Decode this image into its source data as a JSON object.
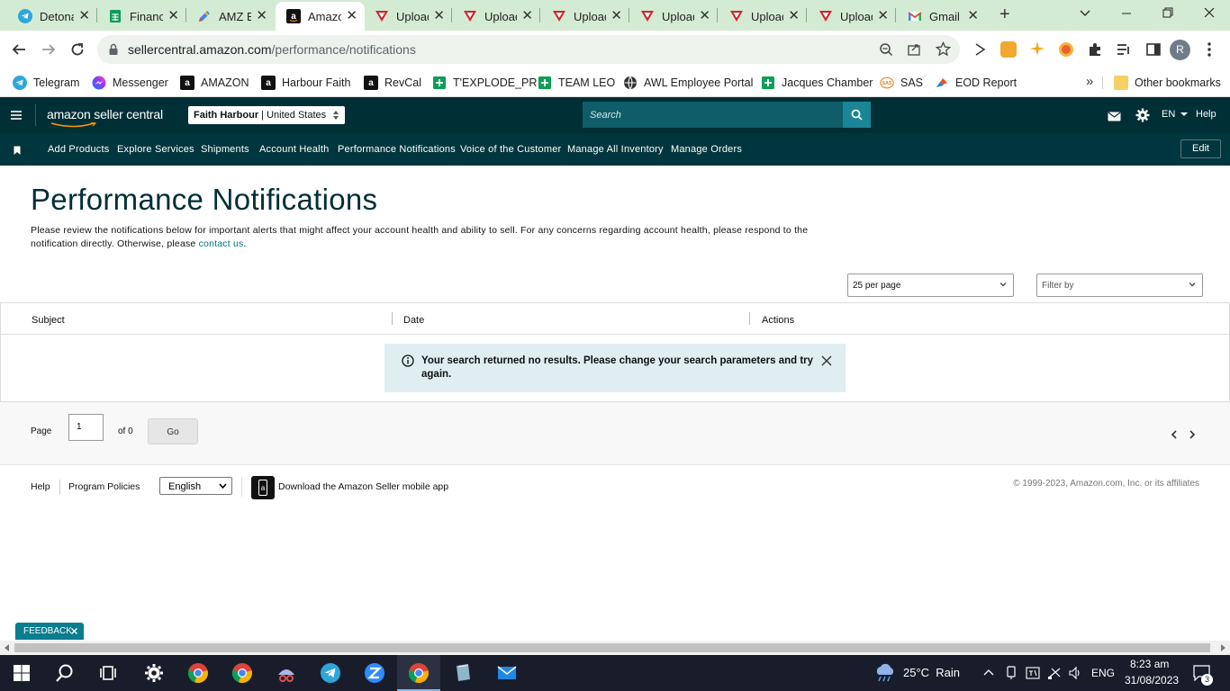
{
  "browser": {
    "tabs": [
      {
        "title": "Detonate",
        "icon": "telegram-icon",
        "active": false
      },
      {
        "title": "Financials",
        "icon": "sheets-icon",
        "active": false
      },
      {
        "title": "AMZ Ex",
        "icon": "edit-icon",
        "active": false
      },
      {
        "title": "Amazon",
        "icon": "amazon-icon",
        "active": true
      },
      {
        "title": "Upload",
        "icon": "upload-icon",
        "active": false
      },
      {
        "title": "Upload",
        "icon": "upload-icon",
        "active": false
      },
      {
        "title": "Upload",
        "icon": "upload-icon",
        "active": false
      },
      {
        "title": "Upload",
        "icon": "upload-icon",
        "active": false
      },
      {
        "title": "Upload",
        "icon": "upload-icon",
        "active": false
      },
      {
        "title": "Upload",
        "icon": "upload-icon",
        "active": false
      },
      {
        "title": "Gmail",
        "icon": "gmail-icon",
        "active": false
      }
    ],
    "new_tab_label": "+",
    "url_host": "sellercentral.amazon.com",
    "url_path": "/performance/notifications",
    "profile_initial": "R",
    "bookmarks": [
      {
        "label": "Telegram",
        "icon": "telegram-icon"
      },
      {
        "label": "Messenger",
        "icon": "messenger-icon"
      },
      {
        "label": "AMAZON",
        "icon": "amazon-icon"
      },
      {
        "label": "Harbour Faith",
        "icon": "amazon-icon"
      },
      {
        "label": "RevCal",
        "icon": "amazon-icon"
      },
      {
        "label": "T'EXPLODE_PR",
        "icon": "sheets-icon"
      },
      {
        "label": "TEAM LEO",
        "icon": "sheets-icon"
      },
      {
        "label": "AWL Employee Portal",
        "icon": "globe-icon"
      },
      {
        "label": "Jacques Chamber",
        "icon": "sheets-icon"
      },
      {
        "label": "SAS",
        "icon": "sas-icon"
      },
      {
        "label": "EOD Report",
        "icon": "report-icon"
      }
    ],
    "more_bookmarks": "»",
    "other_bookmarks": "Other bookmarks"
  },
  "seller_central": {
    "logo_text": "amazon seller central",
    "account_name": "Faith Harbour",
    "account_region": "United States",
    "search_placeholder": "Search",
    "language": "EN",
    "help": "Help",
    "nav": [
      "Add Products",
      "Explore Services",
      "Shipments",
      "Account Health",
      "Performance Notifications",
      "Voice of the Customer",
      "Manage All Inventory",
      "Manage Orders"
    ],
    "edit": "Edit"
  },
  "page": {
    "title": "Performance Notifications",
    "intro_line1": "Please review the notifications below for important alerts that might affect your account health and ability to sell. For any concerns regarding account health, please respond to the",
    "intro_line2": "notification directly. Otherwise, please ",
    "intro_link": "contact us",
    "intro_end": ".",
    "per_page": "25 per page",
    "filter_placeholder": "Filter by",
    "columns": [
      "Subject",
      "Date",
      "Actions"
    ],
    "no_results": "Your search returned no results. Please change your search parameters and try again.",
    "pager": {
      "page_label": "Page",
      "page_value": "1",
      "of_label": "of 0",
      "go": "Go"
    }
  },
  "footer": {
    "help": "Help",
    "policies": "Program Policies",
    "language": "English",
    "app_text": "Download the Amazon Seller mobile app",
    "copyright": "© 1999-2023, Amazon.com, Inc. or its affiliates"
  },
  "feedback": "FEEDBACK",
  "taskbar": {
    "weather": "25°C  Rain",
    "lang": "ENG",
    "time": "8:23 am",
    "date": "31/08/2023",
    "notifications": "3"
  },
  "colors": {
    "header": "#002f36",
    "nav": "#00363d",
    "tabstrip": "#d4ebd3",
    "accent": "#007185",
    "alert_bg": "#deeef1"
  }
}
